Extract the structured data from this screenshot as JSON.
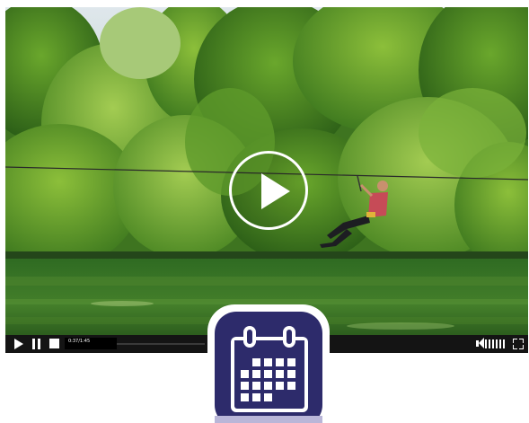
{
  "player": {
    "time_display": "0:37/1:45",
    "scene_description_icon": "video-frame",
    "icons": {
      "big_play": "play-icon",
      "play": "play-icon",
      "pause": "pause-icon",
      "stop": "stop-icon",
      "volume": "volume-icon",
      "fullscreen": "fullscreen-icon"
    },
    "colors": {
      "control_bar": "#141414",
      "play_button": "#ffffff"
    }
  },
  "badge": {
    "icon": "calendar-icon",
    "colors": {
      "primary": "#2d2b6b",
      "cells": "#ffffff"
    }
  }
}
